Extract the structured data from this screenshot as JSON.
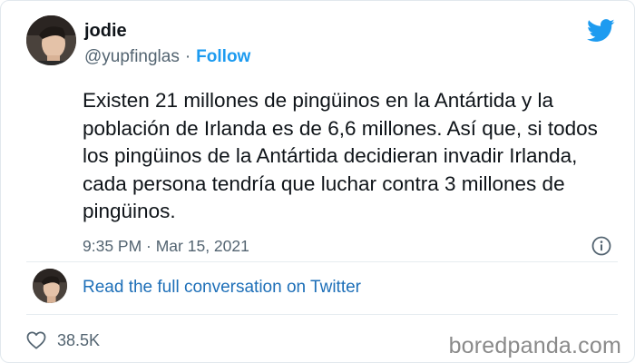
{
  "user": {
    "name": "jodie",
    "handle": "@yupfinglas",
    "separator": "·",
    "follow_label": "Follow"
  },
  "tweet": {
    "text": "Existen 21 millones de pingüinos en la Antártida y la población de Irlanda es de 6,6 millones. Así que, si todos los pingüinos de la Antártida decidieran invadir Irlanda, cada persona tendría que luchar contra 3 millones de pingüinos.",
    "timestamp": "9:35 PM · Mar 15, 2021"
  },
  "conversation_link": "Read the full conversation on Twitter",
  "likes_count": "38.5K",
  "watermark": "boredpanda.com",
  "colors": {
    "twitter_blue": "#1d9bf0",
    "text": "#0f1419",
    "muted": "#536471"
  },
  "icons": {
    "brand": "twitter-bird-icon",
    "info": "info-icon",
    "like": "heart-icon"
  }
}
